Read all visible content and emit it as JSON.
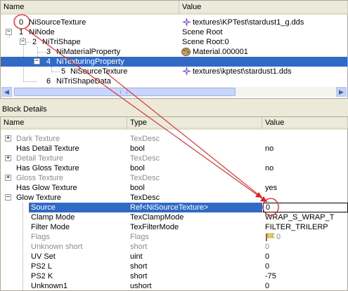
{
  "top": {
    "headers": {
      "name": "Name",
      "value": "Value"
    },
    "rows": [
      {
        "index": "0",
        "name": "NiSourceTexture",
        "value": "textures\\KPTest\\stardust1_g.dds",
        "icon": "texture-icon"
      },
      {
        "index": "1",
        "name": "NiNode",
        "value": "Scene Root",
        "icon": ""
      },
      {
        "index": "2",
        "name": "NiTriShape",
        "value": "Scene Root:0",
        "icon": ""
      },
      {
        "index": "3",
        "name": "NiMaterialProperty",
        "value": "Material.000001",
        "icon": "material-icon"
      },
      {
        "index": "4",
        "name": "NiTexturingProperty",
        "value": "",
        "icon": ""
      },
      {
        "index": "5",
        "name": "NiSourceTexture",
        "value": "textures\\kptest\\stardust1.dds",
        "icon": "texture-icon"
      },
      {
        "index": "6",
        "name": "NiTriShapeData",
        "value": "",
        "icon": ""
      }
    ]
  },
  "block_details": {
    "title": "Block Details",
    "headers": {
      "name": "Name",
      "type": "Type",
      "value": "Value"
    },
    "rows": [
      {
        "name": "Dark Texture",
        "type": "TexDesc",
        "value": ""
      },
      {
        "name": "Has Detail Texture",
        "type": "bool",
        "value": "no"
      },
      {
        "name": "Detail Texture",
        "type": "TexDesc",
        "value": ""
      },
      {
        "name": "Has Gloss Texture",
        "type": "bool",
        "value": "no"
      },
      {
        "name": "Gloss Texture",
        "type": "TexDesc",
        "value": ""
      },
      {
        "name": "Has Glow Texture",
        "type": "bool",
        "value": "yes"
      },
      {
        "name": "Glow Texture",
        "type": "TexDesc",
        "value": ""
      },
      {
        "name": "Source",
        "type": "Ref<NiSourceTexture>",
        "value": "0"
      },
      {
        "name": "Clamp Mode",
        "type": "TexClampMode",
        "value": "WRAP_S_WRAP_T"
      },
      {
        "name": "Filter Mode",
        "type": "TexFilterMode",
        "value": "FILTER_TRILERP"
      },
      {
        "name": "Flags",
        "type": "Flags",
        "value": "0"
      },
      {
        "name": "Unknown short",
        "type": "short",
        "value": "0"
      },
      {
        "name": "UV Set",
        "type": "uint",
        "value": "0"
      },
      {
        "name": "PS2 L",
        "type": "short",
        "value": "0"
      },
      {
        "name": "PS2 K",
        "type": "short",
        "value": "-75"
      },
      {
        "name": "Unknown1",
        "type": "ushort",
        "value": "0"
      }
    ]
  },
  "colors": {
    "selection": "#316ac5",
    "annotation": "#e02020"
  }
}
